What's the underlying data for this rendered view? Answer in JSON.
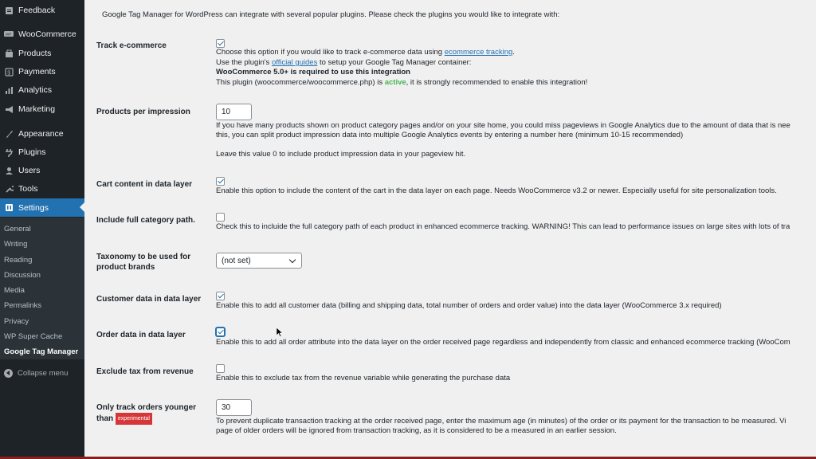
{
  "sidebar": {
    "items": [
      {
        "label": "Feedback",
        "icon": "feedback-icon"
      },
      {
        "label": "WooCommerce",
        "icon": "woocommerce-icon"
      },
      {
        "label": "Products",
        "icon": "products-icon"
      },
      {
        "label": "Payments",
        "icon": "payments-icon"
      },
      {
        "label": "Analytics",
        "icon": "analytics-icon"
      },
      {
        "label": "Marketing",
        "icon": "marketing-icon"
      },
      {
        "label": "Appearance",
        "icon": "appearance-icon"
      },
      {
        "label": "Plugins",
        "icon": "plugins-icon"
      },
      {
        "label": "Users",
        "icon": "users-icon"
      },
      {
        "label": "Tools",
        "icon": "tools-icon"
      },
      {
        "label": "Settings",
        "icon": "settings-icon"
      }
    ],
    "submenu": [
      "General",
      "Writing",
      "Reading",
      "Discussion",
      "Media",
      "Permalinks",
      "Privacy",
      "WP Super Cache",
      "Google Tag Manager"
    ],
    "collapse_label": "Collapse menu"
  },
  "main": {
    "intro": "Google Tag Manager for WordPress can integrate with several popular plugins. Please check the plugins you would like to integrate with:",
    "rows": {
      "track_ecommerce": {
        "label": "Track e-commerce",
        "checked": true,
        "line1_a": "Choose this option if you would like to track e-commerce data using ",
        "line1_link": "ecommerce tracking",
        "line1_b": ".",
        "line2_a": "Use the plugin's ",
        "line2_link": "official guides",
        "line2_b": " to setup your Google Tag Manager container:",
        "line3": "WooCommerce 5.0+ is required to use this integration",
        "line4_a": "This plugin (woocommerce/woocommerce.php) is ",
        "line4_active": "active",
        "line4_b": ", it is strongly recommended to enable this integration!"
      },
      "products_per_impression": {
        "label": "Products per impression",
        "value": "10",
        "line1": "If you have many products shown on product category pages and/or on your site home, you could miss pageviews in Google Analytics due to the amount of data that is nee",
        "line2": "this, you can split product impression data into multiple Google Analytics events by entering a number here (minimum 10-15 recommended)",
        "line3": "Leave this value 0 to include product impression data in your pageview hit."
      },
      "cart_content": {
        "label": "Cart content in data layer",
        "checked": true,
        "desc": "Enable this option to include the content of the cart in the data layer on each page. Needs WooCommerce v3.2 or newer. Especially useful for site personalization tools."
      },
      "full_category_path": {
        "label": "Include full category path.",
        "checked": false,
        "desc": "Check this to incluide the full category path of each product in enhanced ecommerce tracking. WARNING! This can lead to performance issues on large sites with lots of tra"
      },
      "taxonomy_brands": {
        "label": "Taxonomy to be used for product brands",
        "selected": "(not set)"
      },
      "customer_data": {
        "label": "Customer data in data layer",
        "checked": true,
        "desc": "Enable this to add all customer data (billing and shipping data, total number of orders and order value) into the data layer (WooCommerce 3.x required)"
      },
      "order_data": {
        "label": "Order data in data layer",
        "checked": true,
        "desc": "Enable this to add all order attribute into the data layer on the order received page regardless and independently from classic and enhanced ecommerce tracking (WooCom"
      },
      "exclude_tax": {
        "label": "Exclude tax from revenue",
        "checked": false,
        "desc": "Enable this to exclude tax from the revenue variable while generating the purchase data"
      },
      "only_track_orders": {
        "label": "Only track orders younger than",
        "badge": "experimental",
        "value": "30",
        "line1": "To prevent duplicate transaction tracking at the order received page, enter the maximum age (in minutes) of the order or its payment for the transaction to be measured. Vi",
        "line2": "page of older orders will be ignored from transaction tracking, as it is considered to be a measured in an earlier session."
      }
    }
  },
  "colors": {
    "sidebar_bg": "#1d2327",
    "accent": "#2271b1",
    "active_text": "#46b450",
    "badge_bg": "#d63638"
  }
}
